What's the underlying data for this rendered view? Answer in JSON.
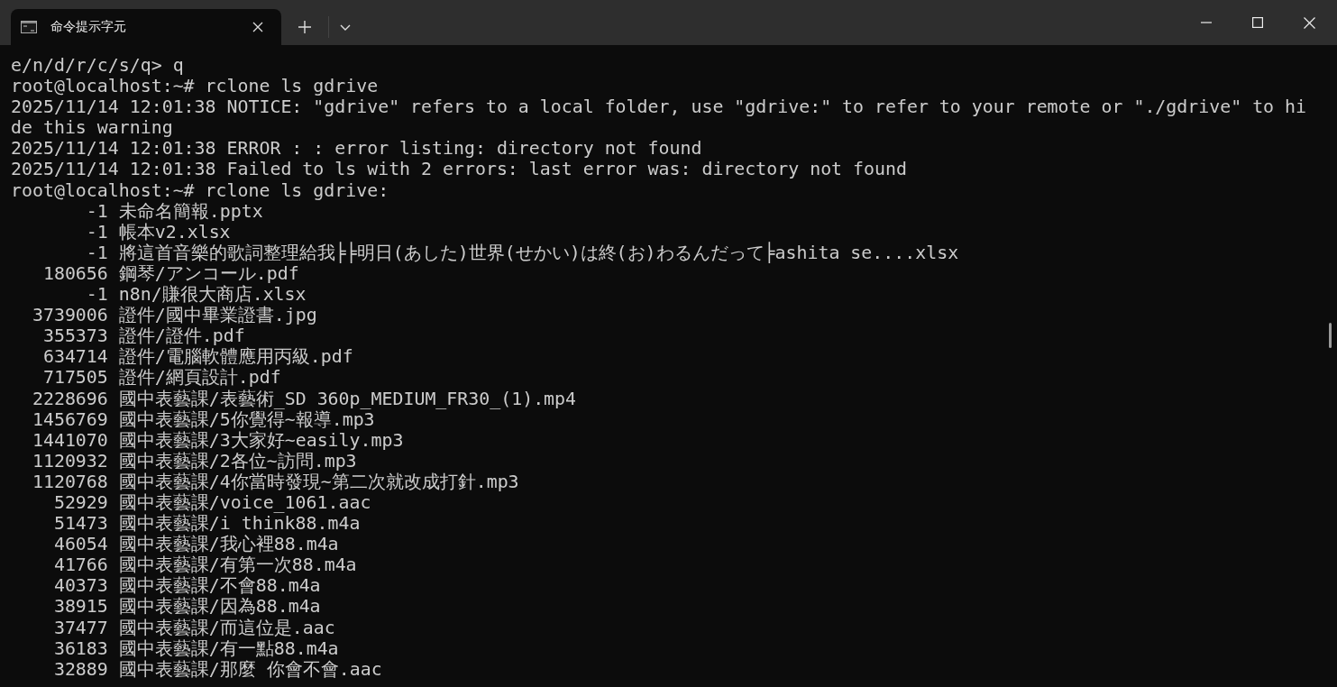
{
  "tabs": [
    {
      "title": "命令提示字元",
      "selected": true
    }
  ],
  "terminal": {
    "lines": [
      "e/n/d/r/c/s/q> q",
      "root@localhost:~# rclone ls gdrive",
      "2025/11/14 12:01:38 NOTICE: \"gdrive\" refers to a local folder, use \"gdrive:\" to refer to your remote or \"./gdrive\" to hi",
      "de this warning",
      "2025/11/14 12:01:38 ERROR : : error listing: directory not found",
      "2025/11/14 12:01:38 Failed to ls with 2 errors: last error was: directory not found",
      "root@localhost:~# rclone ls gdrive:",
      "       -1 未命名簡報.pptx",
      "       -1 帳本v2.xlsx",
      "       -1 將這首音樂的歌詞整理給我╞╞明日(あした)世界(せかい)は終(お)わるんだって╞ashita se....xlsx",
      "   180656 鋼琴/アンコール.pdf",
      "       -1 n8n/賺很大商店.xlsx",
      "  3739006 證件/國中畢業證書.jpg",
      "   355373 證件/證件.pdf",
      "   634714 證件/電腦軟體應用丙級.pdf",
      "   717505 證件/網頁設計.pdf",
      "  2228696 國中表藝課/表藝術_SD 360p_MEDIUM_FR30_(1).mp4",
      "  1456769 國中表藝課/5你覺得~報導.mp3",
      "  1441070 國中表藝課/3大家好~easily.mp3",
      "  1120932 國中表藝課/2各位~訪問.mp3",
      "  1120768 國中表藝課/4你當時發現~第二次就改成打針.mp3",
      "    52929 國中表藝課/voice_1061.aac",
      "    51473 國中表藝課/i think88.m4a",
      "    46054 國中表藝課/我心裡88.m4a",
      "    41766 國中表藝課/有第一次88.m4a",
      "    40373 國中表藝課/不會88.m4a",
      "    38915 國中表藝課/因為88.m4a",
      "    37477 國中表藝課/而這位是.aac",
      "    36183 國中表藝課/有一點88.m4a",
      "    32889 國中表藝課/那麼 你會不會.aac"
    ]
  }
}
